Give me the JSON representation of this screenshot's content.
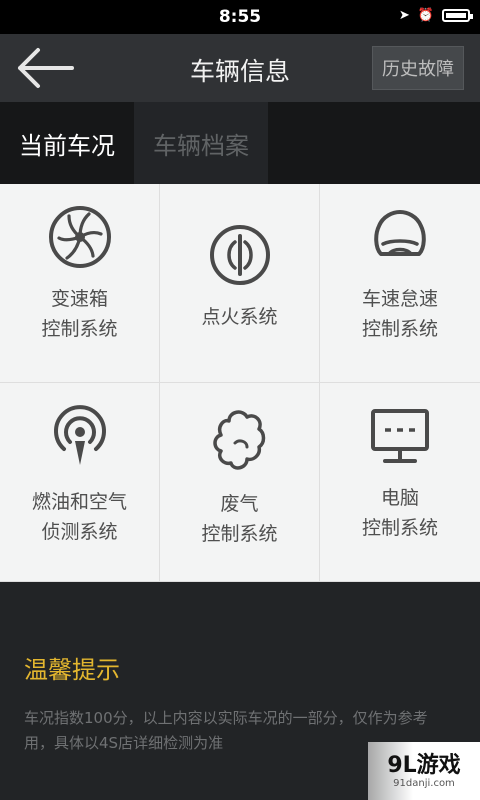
{
  "status_bar": {
    "time": "8:55"
  },
  "navbar": {
    "title": "车辆信息",
    "history_button": "历史故障"
  },
  "tabs": [
    {
      "label": "当前车况",
      "active": true
    },
    {
      "label": "车辆档案",
      "active": false
    }
  ],
  "systems": [
    {
      "label": "变速箱\n控制系统",
      "icon": "turbine-icon"
    },
    {
      "label": "点火系统",
      "icon": "ignition-icon"
    },
    {
      "label": "车速怠速\n控制系统",
      "icon": "car-seat-icon"
    },
    {
      "label": "燃油和空气\n侦测系统",
      "icon": "sensor-signal-icon"
    },
    {
      "label": "废气\n控制系统",
      "icon": "exhaust-cloud-icon"
    },
    {
      "label": "电脑\n控制系统",
      "icon": "computer-monitor-icon"
    }
  ],
  "tips": {
    "title": "温馨提示",
    "text": "车况指数100分，以上内容以实际车况的一部分，仅作为参考用，具体以4S店详细检测为准"
  },
  "watermark": {
    "title": "9L游戏",
    "subtitle": "91danji.com"
  },
  "colors": {
    "accent": "#e3b62f",
    "icon_stroke": "#4a4a4a"
  }
}
